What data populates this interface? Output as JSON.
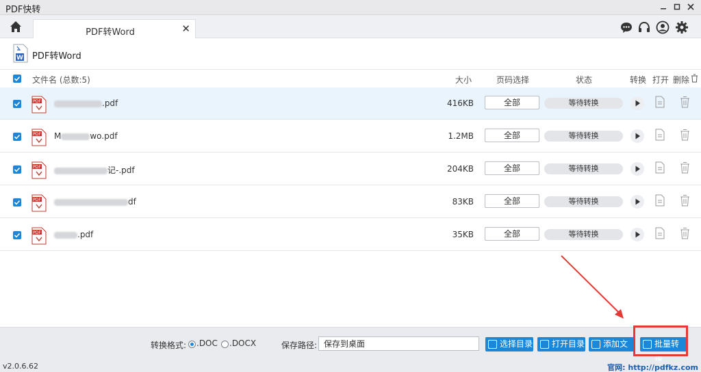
{
  "window": {
    "title": "PDF快转",
    "controls": [
      "minimize-icon",
      "maximize-icon",
      "close-icon"
    ]
  },
  "tabs": [
    {
      "label": "PDF转Word",
      "active": true
    }
  ],
  "toolbar_icons": [
    "chat-icon",
    "headset-icon",
    "user-icon",
    "gear-icon"
  ],
  "page": {
    "title": "PDF转Word"
  },
  "list_header": {
    "filename": "文件名 (总数:5)",
    "size": "大小",
    "pages": "页码选择",
    "status": "状态",
    "convert": "转换",
    "open": "打开",
    "delete": "删除"
  },
  "files": [
    {
      "name_suffix": ".pdf",
      "size": "416KB",
      "pages": "全部",
      "status": "等待转换",
      "checked": true,
      "selected": true
    },
    {
      "name_prefix": "M",
      "name_suffix": "wo.pdf",
      "size": "1.2MB",
      "pages": "全部",
      "status": "等待转换",
      "checked": true
    },
    {
      "name_suffix": "记-.pdf",
      "size": "204KB",
      "pages": "全部",
      "status": "等待转换",
      "checked": true
    },
    {
      "name_suffix": "df",
      "size": "83KB",
      "pages": "全部",
      "status": "等待转换",
      "checked": true
    },
    {
      "name_suffix": ".pdf",
      "size": "35KB",
      "pages": "全部",
      "status": "等待转换",
      "checked": true
    }
  ],
  "footer": {
    "format_label": "转换格式:",
    "format_options": [
      ".DOC",
      ".DOCX"
    ],
    "format_selected": ".DOC",
    "path_label": "保存路径:",
    "path_value": "保存到桌面",
    "buttons": {
      "choose_dir": "选择目录",
      "open_dir": "打开目录",
      "add_file": "添加文件",
      "batch_convert": "批量转换"
    }
  },
  "statusbar": {
    "version": "v2.0.6.62",
    "website": "官网: http://pdfkz.com"
  },
  "colors": {
    "accent": "#1a87d8",
    "highlight": "#e53935",
    "pdf_red": "#c0392b"
  }
}
